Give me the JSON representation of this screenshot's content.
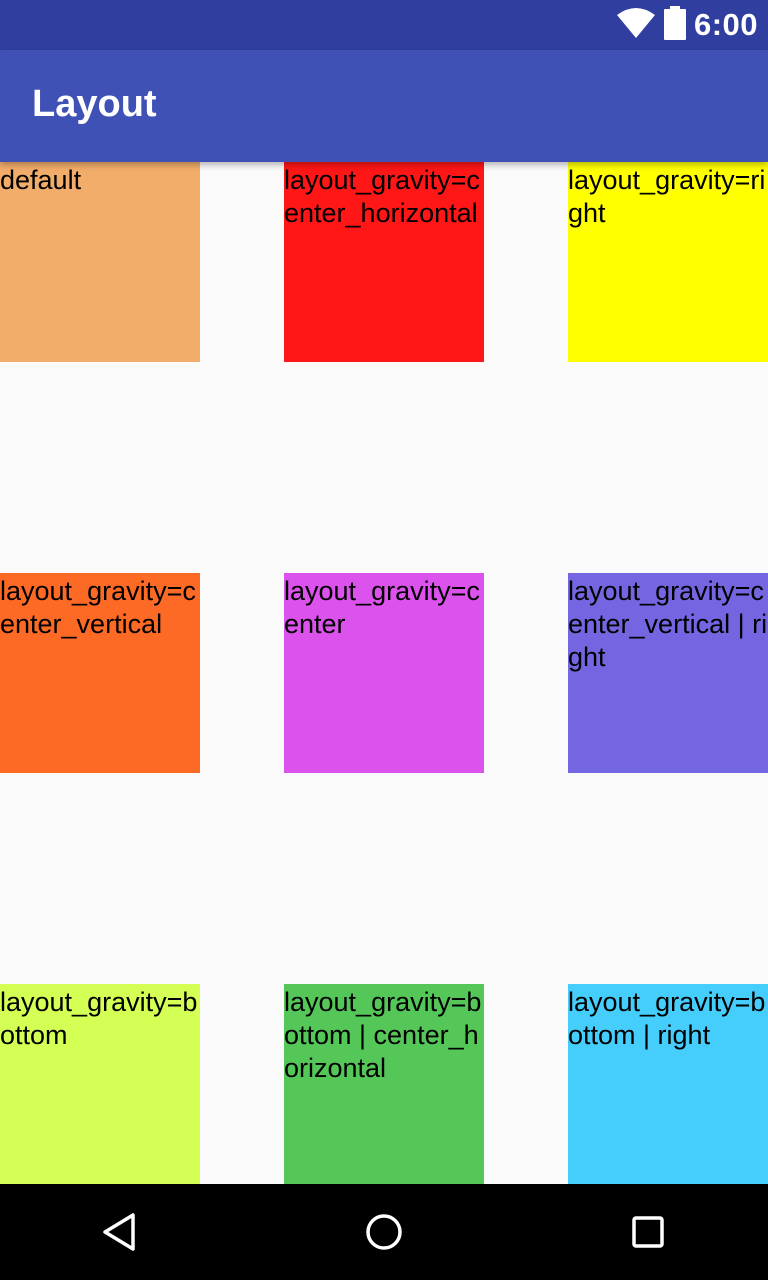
{
  "status_bar": {
    "time": "6:00",
    "icons": [
      "wifi-icon",
      "battery-icon"
    ],
    "background": "#303f9f"
  },
  "app_bar": {
    "title": "Layout",
    "background": "#3f51b5"
  },
  "boxes": [
    {
      "label": "default",
      "color": "#f2ad6b"
    },
    {
      "label": "layout_gravity=center_horizontal",
      "color": "#ff1616"
    },
    {
      "label": "layout_gravity=right",
      "color": "#ffff00"
    },
    {
      "label": "layout_gravity=center_vertical",
      "color": "#fc6a26"
    },
    {
      "label": "layout_gravity=center",
      "color": "#dc52ec"
    },
    {
      "label": "layout_gravity=center_vertical | right",
      "color": "#7366e0"
    },
    {
      "label": "layout_gravity=bottom",
      "color": "#d4ff54"
    },
    {
      "label": "layout_gravity=bottom | center_horizontal",
      "color": "#55c758"
    },
    {
      "label": "layout_gravity=bottom | right",
      "color": "#45cdfc"
    }
  ],
  "nav_bar": {
    "buttons": [
      "back-icon",
      "home-icon",
      "recents-icon"
    ]
  },
  "colors": {
    "content_background": "#fafafa",
    "nav_background": "#000000"
  }
}
